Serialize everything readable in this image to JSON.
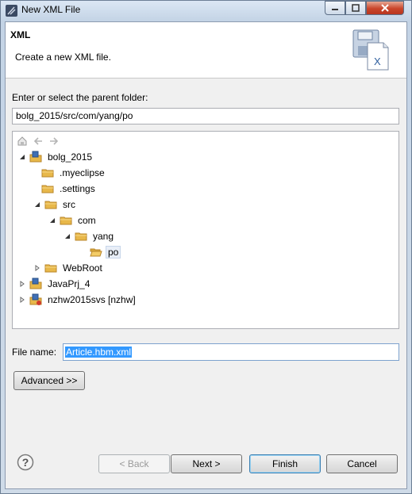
{
  "window": {
    "title": "New XML File"
  },
  "header": {
    "title": "XML",
    "description": "Create a new XML file."
  },
  "folder": {
    "label": "Enter or select the parent folder:",
    "path": "bolg_2015/src/com/yang/po"
  },
  "tree": {
    "items": [
      {
        "label": "bolg_2015",
        "icon": "project-icon",
        "expanded": true,
        "selected": false
      },
      {
        "label": ".myeclipse",
        "icon": "folder-icon"
      },
      {
        "label": ".settings",
        "icon": "folder-icon"
      },
      {
        "label": "src",
        "icon": "folder-icon",
        "expanded": true
      },
      {
        "label": "com",
        "icon": "folder-icon",
        "expanded": true
      },
      {
        "label": "yang",
        "icon": "folder-icon",
        "expanded": true
      },
      {
        "label": "po",
        "icon": "folder-open-icon",
        "selected": true
      },
      {
        "label": "WebRoot",
        "icon": "folder-icon",
        "expanded": false
      },
      {
        "label": "JavaPrj_4",
        "icon": "project-icon",
        "expanded": false
      },
      {
        "label": "nzhw2015svs [nzhw]",
        "icon": "project-svn-icon",
        "expanded": false
      }
    ]
  },
  "file": {
    "label": "File name:",
    "value": "Article.hbm.xml"
  },
  "buttons": {
    "advanced": "Advanced >>",
    "back": "< Back",
    "next": "Next >",
    "finish": "Finish",
    "cancel": "Cancel"
  },
  "colors": {
    "selection": "#3399ff",
    "folder": "#e8b84a",
    "close_button": "#c9452a"
  }
}
